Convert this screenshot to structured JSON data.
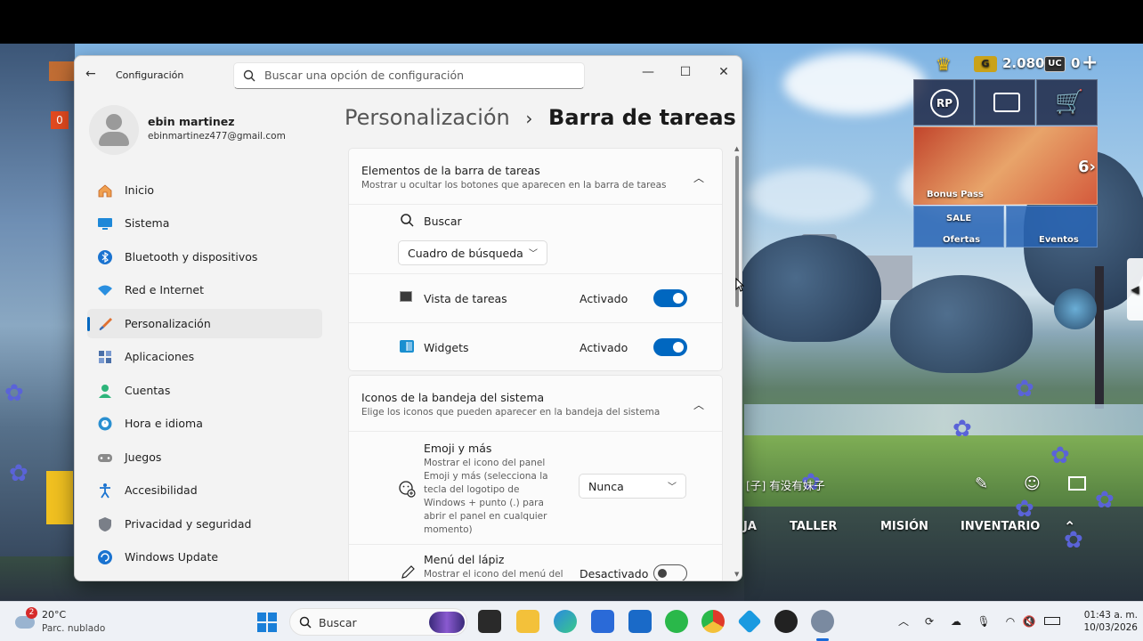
{
  "window": {
    "app_title": "Configuración",
    "search_placeholder": "Buscar una opción de configuración"
  },
  "profile": {
    "name": "ebin martinez",
    "email": "ebinmartinez477@gmail.com"
  },
  "sidebar": {
    "items": [
      {
        "label": "Inicio",
        "icon": "home-icon",
        "active": false
      },
      {
        "label": "Sistema",
        "icon": "monitor-icon",
        "active": false
      },
      {
        "label": "Bluetooth y dispositivos",
        "icon": "bluetooth-icon",
        "active": false
      },
      {
        "label": "Red e Internet",
        "icon": "wifi-icon",
        "active": false
      },
      {
        "label": "Personalización",
        "icon": "brush-icon",
        "active": true
      },
      {
        "label": "Aplicaciones",
        "icon": "apps-icon",
        "active": false
      },
      {
        "label": "Cuentas",
        "icon": "account-icon",
        "active": false
      },
      {
        "label": "Hora e idioma",
        "icon": "globe-clock-icon",
        "active": false
      },
      {
        "label": "Juegos",
        "icon": "gamepad-icon",
        "active": false
      },
      {
        "label": "Accesibilidad",
        "icon": "accessibility-icon",
        "active": false
      },
      {
        "label": "Privacidad y seguridad",
        "icon": "shield-icon",
        "active": false
      },
      {
        "label": "Windows Update",
        "icon": "update-icon",
        "active": false
      }
    ]
  },
  "breadcrumb": {
    "parent": "Personalización",
    "separator": "›",
    "current": "Barra de tareas"
  },
  "taskbar_items": {
    "title": "Elementos de la barra de tareas",
    "subtitle": "Mostrar u ocultar los botones que aparecen en la barra de tareas",
    "search_label": "Buscar",
    "search_dropdown": "Cuadro de búsqueda",
    "task_view_label": "Vista de tareas",
    "task_view_state": "Activado",
    "widgets_label": "Widgets",
    "widgets_state": "Activado"
  },
  "tray_icons": {
    "title": "Iconos de la bandeja del sistema",
    "subtitle": "Elige los iconos que pueden aparecer en la bandeja del sistema",
    "emoji_label": "Emoji y más",
    "emoji_desc": "Mostrar el icono del panel Emoji y más (selecciona la tecla del logotipo de Windows + punto (.) para abrir el panel en cualquier momento)",
    "emoji_dropdown": "Nunca",
    "pen_label": "Menú del lápiz",
    "pen_desc": "Mostrar el icono del menú del",
    "pen_state": "Desactivado"
  },
  "game_hud": {
    "coins": "2.080",
    "uc": "0",
    "bonus_pass": "Bonus Pass",
    "ofertas": "Ofertas",
    "eventos": "Eventos",
    "sale": "SALE",
    "chat": "[子] 有没有妹子",
    "menu_taller": "TALLER",
    "menu_mision": "MISIÓN",
    "menu_inventario": "INVENTARIO",
    "menu_partial": "JA"
  },
  "system_taskbar": {
    "weather_temp": "20°C",
    "weather_desc": "Parc. nublado",
    "weather_badge": "2",
    "search_label": "Buscar",
    "time": "01:43 a. m.",
    "date": "10/03/2026"
  },
  "colors": {
    "accent": "#0067c0",
    "window_bg": "#f3f3f3",
    "card_bg": "#fbfbfb"
  }
}
